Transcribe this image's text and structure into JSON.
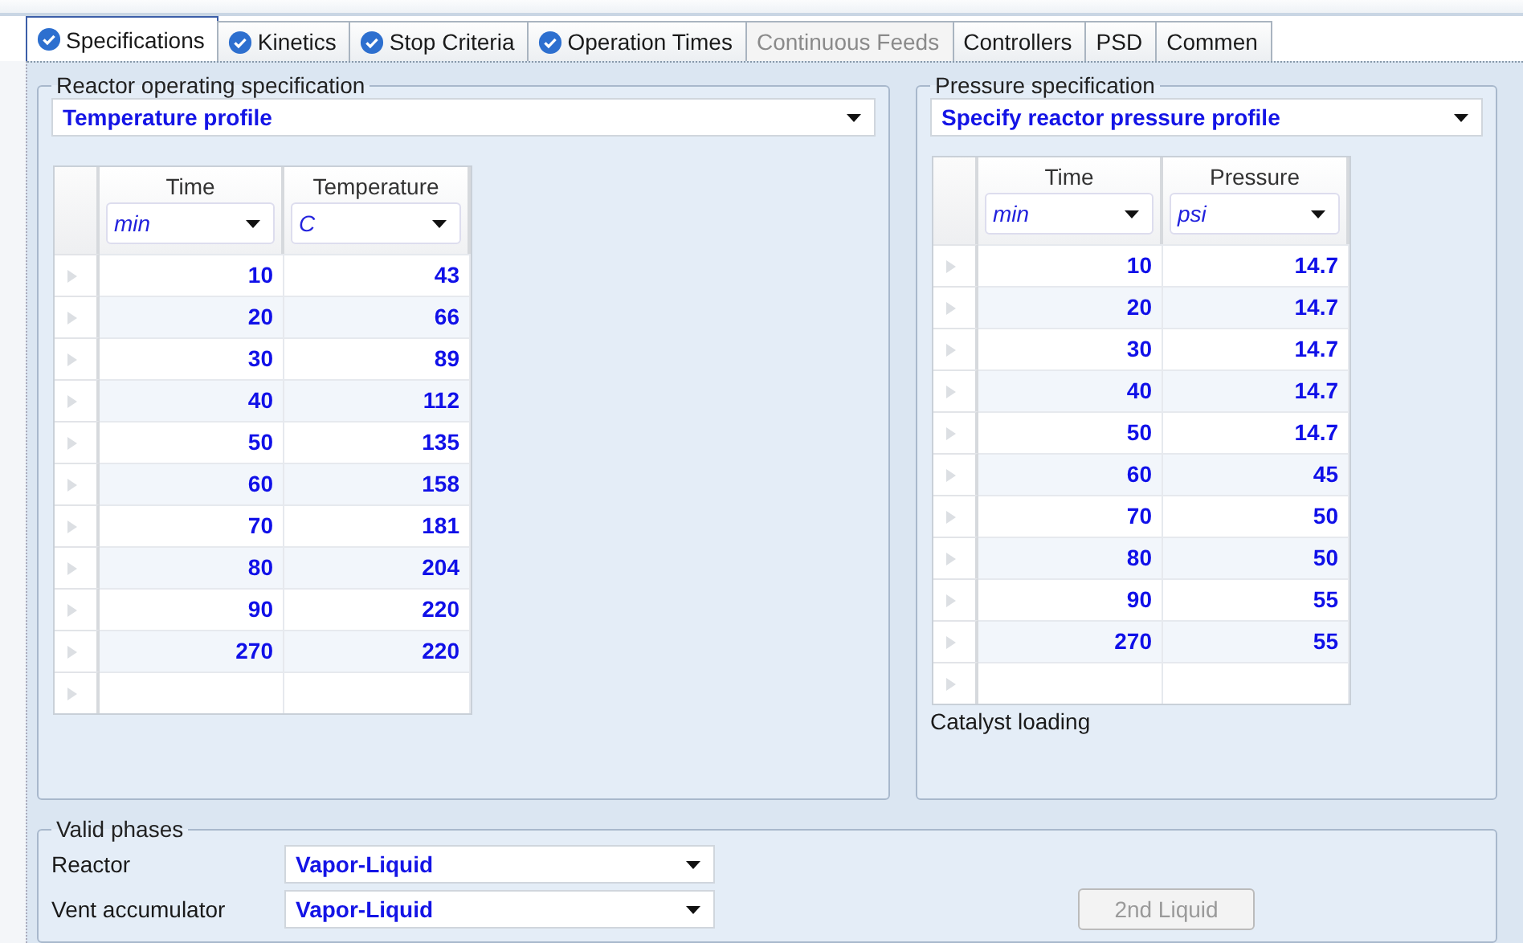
{
  "tabs": [
    {
      "label": "Specifications",
      "checked": true,
      "disabled": false,
      "selected": true
    },
    {
      "label": "Kinetics",
      "checked": true,
      "disabled": false,
      "selected": false
    },
    {
      "label": "Stop Criteria",
      "checked": true,
      "disabled": false,
      "selected": false
    },
    {
      "label": "Operation Times",
      "checked": true,
      "disabled": false,
      "selected": false
    },
    {
      "label": "Continuous Feeds",
      "checked": false,
      "disabled": true,
      "selected": false
    },
    {
      "label": "Controllers",
      "checked": false,
      "disabled": false,
      "selected": false
    },
    {
      "label": "PSD",
      "checked": false,
      "disabled": false,
      "selected": false
    },
    {
      "label": "Commen",
      "checked": false,
      "disabled": false,
      "selected": false
    }
  ],
  "reactor_spec": {
    "legend": "Reactor operating specification",
    "mode": "Temperature profile",
    "columns": [
      {
        "name": "Time",
        "unit": "min"
      },
      {
        "name": "Temperature",
        "unit": "C"
      }
    ],
    "rows": [
      [
        "10",
        "43"
      ],
      [
        "20",
        "66"
      ],
      [
        "30",
        "89"
      ],
      [
        "40",
        "112"
      ],
      [
        "50",
        "135"
      ],
      [
        "60",
        "158"
      ],
      [
        "70",
        "181"
      ],
      [
        "80",
        "204"
      ],
      [
        "90",
        "220"
      ],
      [
        "270",
        "220"
      ]
    ]
  },
  "pressure_spec": {
    "legend": "Pressure specification",
    "mode": "Specify reactor pressure profile",
    "columns": [
      {
        "name": "Time",
        "unit": "min"
      },
      {
        "name": "Pressure",
        "unit": "psi"
      }
    ],
    "rows": [
      [
        "10",
        "14.7"
      ],
      [
        "20",
        "14.7"
      ],
      [
        "30",
        "14.7"
      ],
      [
        "40",
        "14.7"
      ],
      [
        "50",
        "14.7"
      ],
      [
        "60",
        "45"
      ],
      [
        "70",
        "50"
      ],
      [
        "80",
        "50"
      ],
      [
        "90",
        "55"
      ],
      [
        "270",
        "55"
      ]
    ],
    "footer_label": "Catalyst loading"
  },
  "valid_phases": {
    "legend": "Valid phases",
    "fields": [
      {
        "label": "Reactor",
        "value": "Vapor-Liquid"
      },
      {
        "label": "Vent accumulator",
        "value": "Vapor-Liquid"
      }
    ],
    "button": {
      "label": "2nd Liquid",
      "disabled": true
    }
  }
}
